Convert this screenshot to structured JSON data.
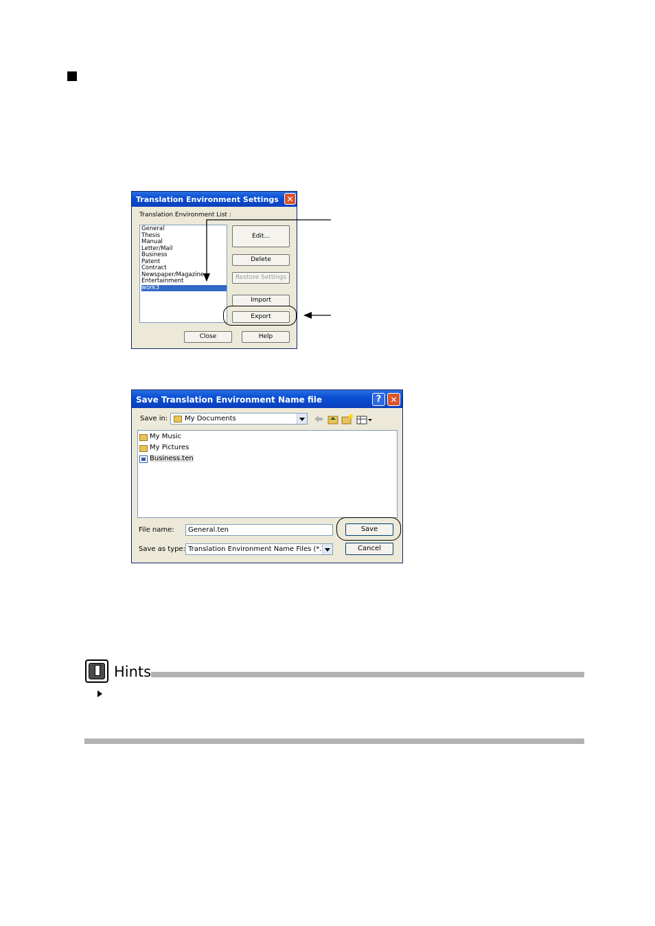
{
  "dialog1": {
    "title": "Translation Environment Settings",
    "close_glyph": "✕",
    "list_label": "Translation Environment List :",
    "items": [
      "General",
      "Thesis",
      "Manual",
      "Letter/Mail",
      "Business",
      "Patent",
      "Contract",
      "Newspaper/Magazine",
      "Entertainment",
      "work3"
    ],
    "selected_index": 9,
    "buttons": {
      "edit": "Edit...",
      "delete": "Delete",
      "restore": "Restore Settings",
      "import": "Import",
      "export": "Export",
      "close": "Close",
      "help": "Help"
    }
  },
  "dialog2": {
    "title": "Save Translation Environment Name file",
    "help_glyph": "?",
    "close_glyph": "✕",
    "save_in_label": "Save in:",
    "save_in_value": "My Documents",
    "files": [
      {
        "name": "My Music",
        "icon": "folder-icon"
      },
      {
        "name": "My Pictures",
        "icon": "folder-icon"
      },
      {
        "name": "Business.ten",
        "icon": "ten-file-icon"
      }
    ],
    "file_name_label": "File name:",
    "file_name_value": "General.ten",
    "save_as_label": "Save as type:",
    "save_as_value": "Translation Environment Name Files (*.TEN)",
    "save_button": "Save",
    "cancel_button": "Cancel"
  },
  "hints": {
    "title": "Hints"
  },
  "colors": {
    "selection": "#316ac5",
    "dialog_bg": "#ece9d8",
    "hint_bar": "#b3b3b3"
  }
}
